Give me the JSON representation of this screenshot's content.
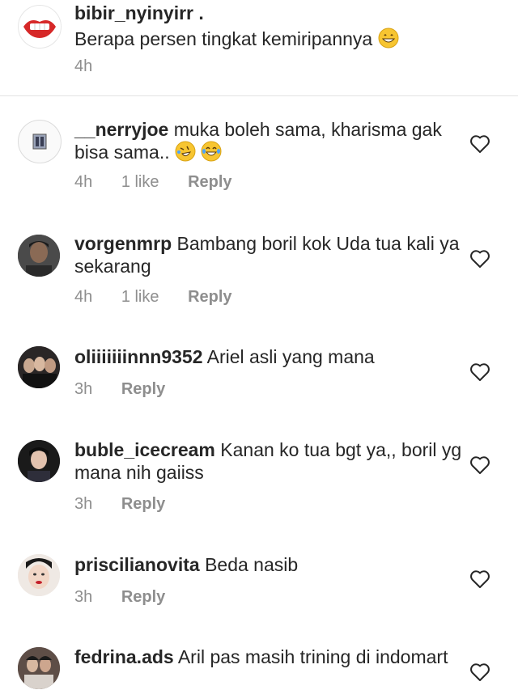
{
  "comments": [
    {
      "username": "bibir_nyinyirr .",
      "text": "Berapa persen tingkat kemiripannya",
      "time": "4h",
      "avatar_icon": "lips-avatar-icon"
    },
    {
      "username": "__nerryjoe",
      "text": "muka boleh sama, kharisma gak bisa sama..",
      "time": "4h",
      "likes": "1 like",
      "reply": "Reply"
    },
    {
      "username": "vorgenmrp",
      "text": "Bambang boril kok Uda tua kali ya sekarang",
      "time": "4h",
      "likes": "1 like",
      "reply": "Reply"
    },
    {
      "username": "oliiiiiiinnn9352",
      "text": "Ariel asli yang mana",
      "time": "3h",
      "reply": "Reply"
    },
    {
      "username": "buble_icecream",
      "text": "Kanan ko tua bgt ya,, boril yg mana nih gaiiss",
      "time": "3h",
      "reply": "Reply"
    },
    {
      "username": "priscilianovita",
      "text": "Beda nasib",
      "time": "3h",
      "reply": "Reply"
    },
    {
      "username": "fedrina.ads",
      "text": "Aril pas masih trining di indomart"
    }
  ],
  "colors": {
    "text": "#262626",
    "meta": "#8e8e8e",
    "divider": "#e3e3e3"
  }
}
